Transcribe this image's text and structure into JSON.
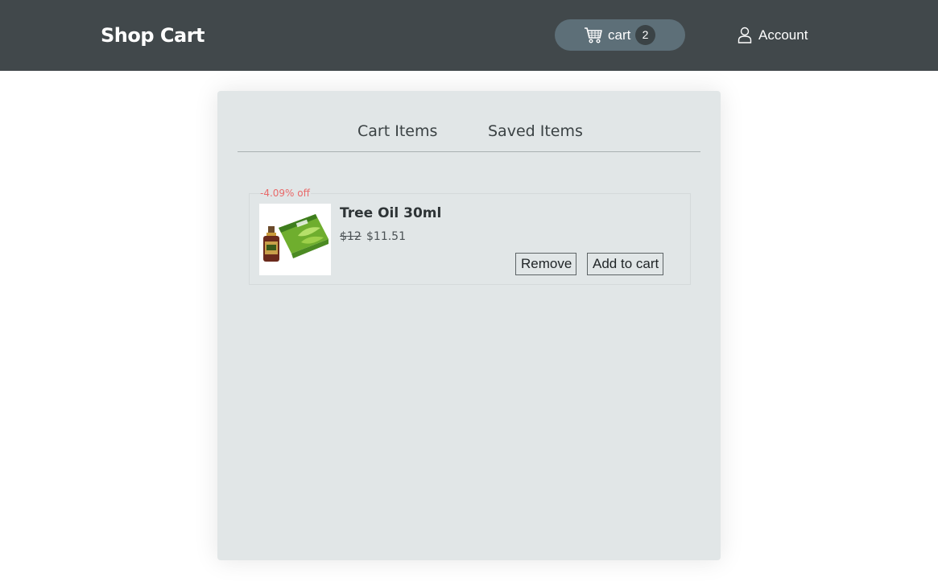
{
  "header": {
    "brand": "Shop Cart",
    "cart_label": "cart",
    "cart_count": "2",
    "account_label": "Account"
  },
  "tabs": [
    {
      "label": "Cart Items"
    },
    {
      "label": "Saved Items"
    }
  ],
  "item": {
    "discount": "-4.09% off",
    "title": "Tree Oil 30ml",
    "old_price": "$12",
    "new_price": "$11.51",
    "remove_label": "Remove",
    "add_label": "Add to cart"
  },
  "colors": {
    "header_bg": "#41484b",
    "cart_pill": "#5d6f78",
    "panel_bg": "#e1e6e7",
    "discount": "#e86a6a"
  },
  "icons": {
    "cart": "shopping-cart-icon",
    "account": "user-icon"
  }
}
